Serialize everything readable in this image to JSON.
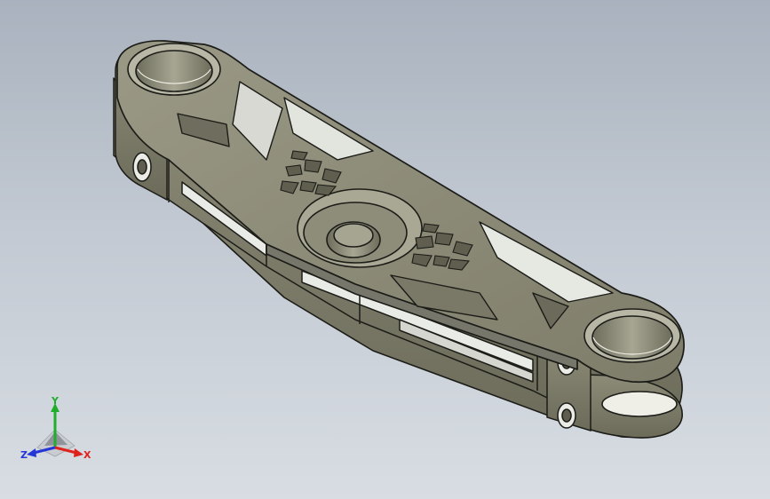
{
  "triad": {
    "x_label": "X",
    "y_label": "Y",
    "z_label": "Z",
    "x_color": "#e0221c",
    "y_color": "#1fae2b",
    "z_color": "#2436d6"
  },
  "model": {
    "part": "triple-clamp",
    "fill_color": "#8c8b78",
    "edge_color": "#1c1c18",
    "hole_color": "#ffffff"
  }
}
